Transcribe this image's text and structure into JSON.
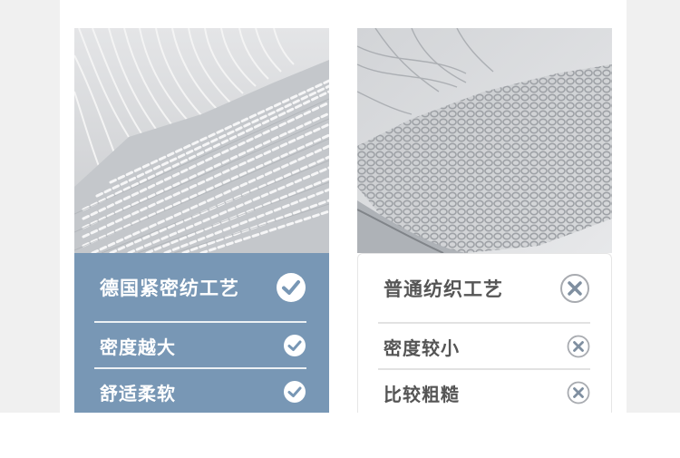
{
  "left_card": {
    "title": "德国紧密纺工艺",
    "title_icon": "check-circle-icon",
    "items": [
      {
        "label": "密度越大",
        "icon": "check-circle-icon"
      },
      {
        "label": "舒适柔软",
        "icon": "check-circle-icon"
      }
    ],
    "accent_color": "#7897b5"
  },
  "right_card": {
    "title": "普通纺织工艺",
    "title_icon": "cross-circle-icon",
    "items": [
      {
        "label": "密度较小",
        "icon": "cross-circle-icon"
      },
      {
        "label": "比较粗糙",
        "icon": "cross-circle-icon"
      }
    ],
    "accent_color": "#ffffff"
  }
}
